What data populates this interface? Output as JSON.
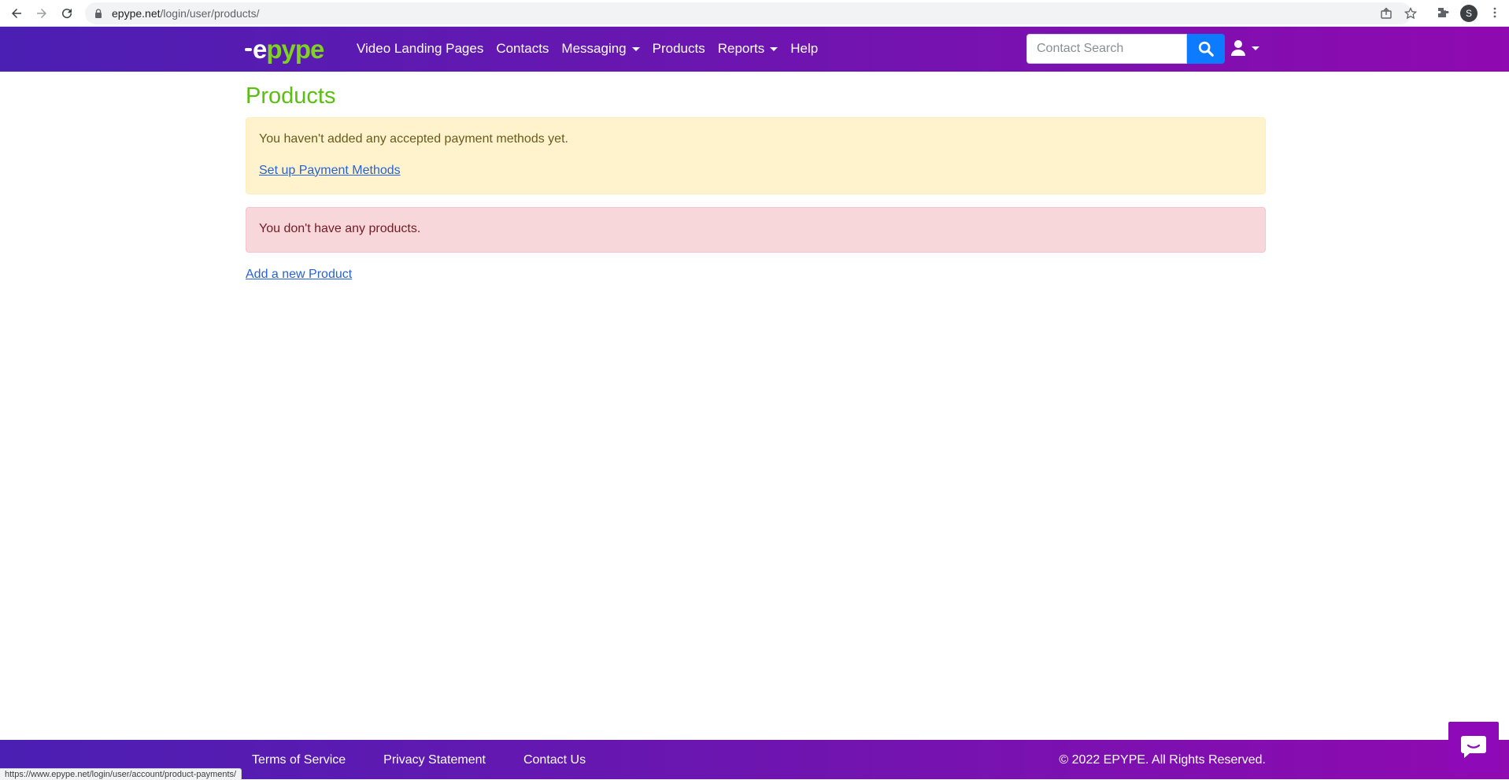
{
  "browser": {
    "url_host": "epype.net",
    "url_path": "/login/user/products/",
    "profile_initial": "S",
    "status_url": "https://www.epype.net/login/user/account/product-payments/"
  },
  "navbar": {
    "brand_prefix": "e",
    "brand_suffix": "pype",
    "links": [
      {
        "label": "Video Landing Pages"
      },
      {
        "label": "Contacts"
      },
      {
        "label": "Messaging"
      },
      {
        "label": "Products"
      },
      {
        "label": "Reports"
      },
      {
        "label": "Help"
      }
    ],
    "search_placeholder": "Contact Search"
  },
  "main": {
    "title": "Products",
    "warning_text": "You haven't added any accepted payment methods yet.",
    "warning_link": "Set up Payment Methods",
    "empty_text": "You don't have any products.",
    "add_link": "Add a new Product"
  },
  "footer": {
    "links": [
      {
        "label": "Terms of Service"
      },
      {
        "label": "Privacy Statement"
      },
      {
        "label": "Contact Us"
      }
    ],
    "copyright": "© 2022 EPYPE. All Rights Reserved."
  },
  "colors": {
    "brand_green": "#59c010",
    "nav_gradient_start": "#4b1fb3",
    "nav_gradient_end": "#8f0ab0",
    "search_button": "#0d7bff",
    "chat_button": "#8e0ab8"
  }
}
